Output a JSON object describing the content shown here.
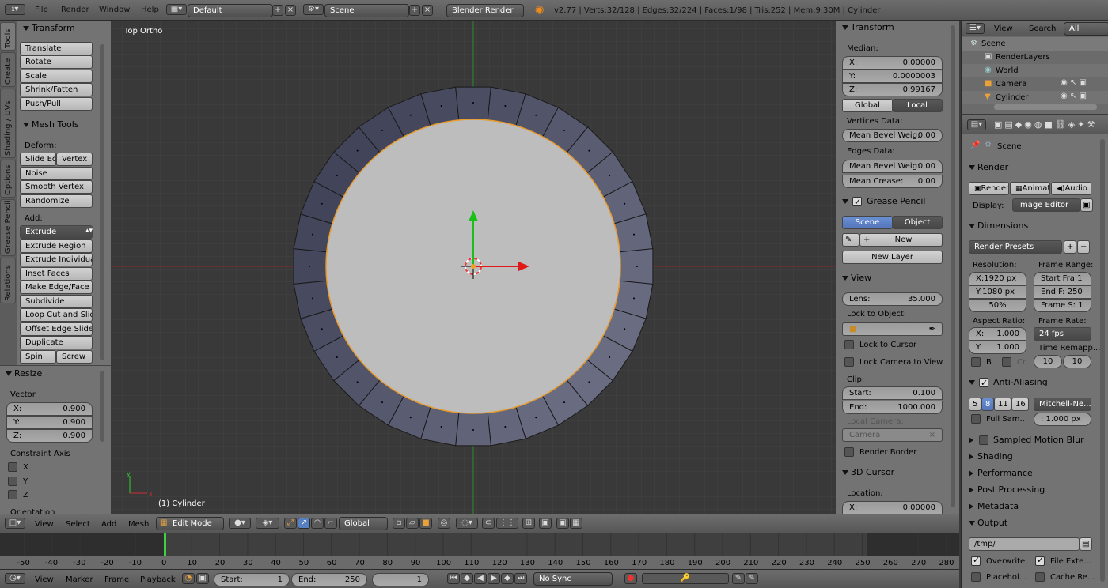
{
  "topbar": {
    "menus": [
      "File",
      "Render",
      "Window",
      "Help"
    ],
    "layout": "Default",
    "scene": "Scene",
    "engine": "Blender Render",
    "stats": "v2.77 | Verts:32/128 | Edges:32/224 | Faces:1/98 | Tris:252 | Mem:9.30M | Cylinder"
  },
  "tools": {
    "tabs": [
      "Tools",
      "Create",
      "Shading / UVs",
      "Options",
      "Grease Pencil",
      "Relations"
    ],
    "transform_title": "Transform",
    "transform": [
      "Translate",
      "Rotate",
      "Scale",
      "Shrink/Fatten",
      "Push/Pull"
    ],
    "mesh_title": "Mesh Tools",
    "deform_label": "Deform:",
    "slide_edge": "Slide Ed",
    "vertex": "Vertex",
    "deform": [
      "Noise",
      "Smooth Vertex",
      "Randomize"
    ],
    "add_label": "Add:",
    "extrude": "Extrude",
    "add": [
      "Extrude Region",
      "Extrude Individual",
      "Inset Faces",
      "Make Edge/Face",
      "Subdivide",
      "Loop Cut and Slide",
      "Offset Edge Slide",
      "Duplicate"
    ],
    "spin": "Spin",
    "screw": "Screw"
  },
  "resize": {
    "title": "Resize",
    "vector_label": "Vector",
    "x_label": "X:",
    "x": "0.900",
    "y_label": "Y:",
    "y": "0.900",
    "z_label": "Z:",
    "z": "0.900",
    "constraint_label": "Constraint Axis",
    "axes": [
      "X",
      "Y",
      "Z"
    ],
    "orientation": "Orientation"
  },
  "viewport": {
    "view_name": "Top Ortho",
    "object_label": "(1) Cylinder"
  },
  "npanel": {
    "transform_title": "Transform",
    "median_label": "Median:",
    "x_label": "X:",
    "x": "0.00000",
    "y_label": "Y:",
    "y": "0.0000003",
    "z_label": "Z:",
    "z": "0.99167",
    "global": "Global",
    "local": "Local",
    "vertices_data": "Vertices Data:",
    "mean_bevel_label": "Mean Bevel Weig:",
    "mean_bevel_v": "0.00",
    "edges_data": "Edges Data:",
    "mean_bevel_e": "0.00",
    "mean_crease_label": "Mean Crease:",
    "mean_crease": "0.00",
    "grease_title": "Grease Pencil",
    "gp_scene": "Scene",
    "gp_object": "Object",
    "gp_new": "New",
    "gp_new_layer": "New Layer",
    "view_title": "View",
    "lens_label": "Lens:",
    "lens": "35.000",
    "lock_object": "Lock to Object:",
    "lock_cursor": "Lock to Cursor",
    "lock_camera": "Lock Camera to View",
    "clip_label": "Clip:",
    "start_label": "Start:",
    "clip_start": "0.100",
    "end_label": "End:",
    "clip_end": "1000.000",
    "local_camera": "Local Camera:",
    "camera_field": "Camera",
    "render_border": "Render Border",
    "cursor_title": "3D Cursor",
    "location_label": "Location:",
    "cursor_x_label": "X:",
    "cursor_x": "0.00000"
  },
  "outliner": {
    "view": "View",
    "search": "Search",
    "all_scenes": "All Scenes",
    "items": [
      "Scene",
      "RenderLayers",
      "World",
      "Camera",
      "Cylinder"
    ]
  },
  "props": {
    "scene_label": "Scene",
    "render_title": "Render",
    "render_btn": "Render",
    "anim_btn": "Animati",
    "audio_btn": "Audio",
    "display_label": "Display:",
    "display_value": "Image Editor",
    "dimensions_title": "Dimensions",
    "render_presets": "Render Presets",
    "resolution_label": "Resolution:",
    "frame_range_label": "Frame Range:",
    "res_x": "X:1920 px",
    "res_y": "Y:1080 px",
    "res_pct": "50%",
    "start_frame": "Start Fra:1",
    "end_frame": "End F: 250",
    "frame_step": "Frame S: 1",
    "aspect_label": "Aspect Ratio:",
    "frame_rate_label": "Frame Rate:",
    "aspect_x_label": "X:",
    "aspect_x": "1.000",
    "aspect_y_label": "Y:",
    "aspect_y": "1.000",
    "fps": "24 fps",
    "time_remap": "Time Remapp...",
    "b_label": "B",
    "cr_label": "Cr",
    "remap_old": "10",
    "remap_new": "10",
    "aa_title": "Anti-Aliasing",
    "aa_samples": [
      "5",
      "8",
      "11",
      "16"
    ],
    "aa_filter": "Mitchell-Ne...",
    "full_sample": "Full Sam...",
    "aa_size": ": 1.000 px",
    "sampled_motion": "Sampled Motion Blur",
    "shading": "Shading",
    "performance": "Performance",
    "post_processing": "Post Processing",
    "metadata": "Metadata",
    "output_title": "Output",
    "output_path": "/tmp/",
    "overwrite": "Overwrite",
    "file_ext": "File Exte...",
    "placeholders": "Placehol...",
    "cache": "Cache Re..."
  },
  "view3d_header": {
    "view": "View",
    "select": "Select",
    "add": "Add",
    "mesh": "Mesh",
    "mode": "Edit Mode",
    "orientation": "Global"
  },
  "timeline": {
    "ticks": [
      "-50",
      "-40",
      "-30",
      "-20",
      "-10",
      "0",
      "10",
      "20",
      "30",
      "40",
      "50",
      "60",
      "70",
      "80",
      "90",
      "100",
      "110",
      "120",
      "130",
      "140",
      "150",
      "160",
      "170",
      "180",
      "190",
      "200",
      "210",
      "220",
      "230",
      "240",
      "250",
      "260",
      "270",
      "280"
    ],
    "current_frame": 1,
    "view": "View",
    "marker": "Marker",
    "frame": "Frame",
    "playback": "Playback",
    "start_label": "Start:",
    "start": "1",
    "end_label": "End:",
    "end": "250",
    "current": "1",
    "sync": "No Sync"
  },
  "colors": {
    "selection": "#f0a020",
    "x_axis": "#e02020",
    "y_axis": "#20c020",
    "active_blue": "#5680c2"
  }
}
